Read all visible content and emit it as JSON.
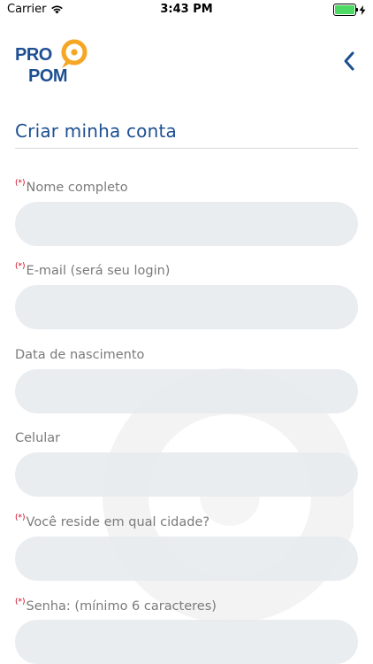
{
  "status_bar": {
    "carrier": "Carrier",
    "time": "3:43 PM",
    "battery_level": 1.0
  },
  "header": {
    "logo_text_line1": "PRO",
    "logo_text_line2": "POM",
    "back_icon": "chevron-left-icon"
  },
  "page": {
    "title": "Criar minha conta"
  },
  "form": {
    "required_marker": "(*)",
    "fields": [
      {
        "label": "Nome completo",
        "required": true,
        "value": ""
      },
      {
        "label": "E-mail (será seu login)",
        "required": true,
        "value": ""
      },
      {
        "label": "Data de nascimento",
        "required": false,
        "value": ""
      },
      {
        "label": "Celular",
        "required": false,
        "value": ""
      },
      {
        "label": "Você reside em qual cidade?",
        "required": true,
        "value": ""
      },
      {
        "label": "Senha: (mínimo 6 caracteres)",
        "required": true,
        "value": ""
      }
    ]
  },
  "colors": {
    "brand_blue": "#1d4f91",
    "brand_orange": "#f5a623",
    "required_red": "#d0021b",
    "input_bg": "#e8ebef",
    "label_gray": "#7a7a7a"
  }
}
